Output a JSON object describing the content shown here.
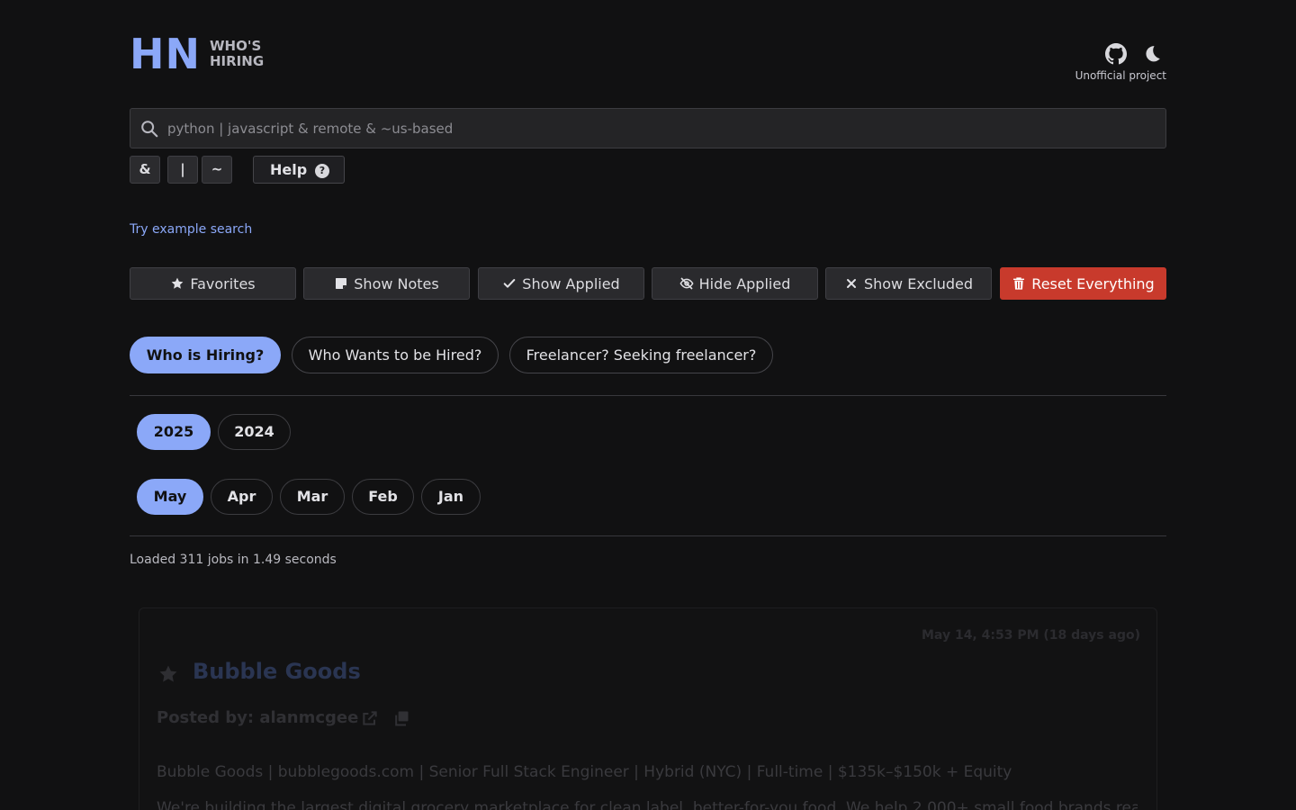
{
  "header": {
    "logo_hn": "HN",
    "logo_line1": "WHO'S",
    "logo_line2": "HIRING",
    "unofficial": "Unofficial project",
    "icons": [
      "github-icon",
      "moon-icon"
    ]
  },
  "search": {
    "placeholder": "python | javascript & remote & ~us-based",
    "value": ""
  },
  "operators": [
    "&",
    "|",
    "~"
  ],
  "help_label": "Help",
  "help_icon_glyph": "?",
  "try_example": "Try example search",
  "filters": [
    {
      "label": "Favorites",
      "icon": "star-icon"
    },
    {
      "label": "Show Notes",
      "icon": "note-icon"
    },
    {
      "label": "Show Applied",
      "icon": "check-icon"
    },
    {
      "label": "Hide Applied",
      "icon": "eye-slash-icon"
    },
    {
      "label": "Show Excluded",
      "icon": "x-icon"
    },
    {
      "label": "Reset Everything",
      "icon": "trash-icon"
    }
  ],
  "categories": [
    {
      "label": "Who is Hiring?",
      "active": true
    },
    {
      "label": "Who Wants to be Hired?",
      "active": false
    },
    {
      "label": "Freelancer? Seeking freelancer?",
      "active": false
    }
  ],
  "years": [
    {
      "label": "2025",
      "active": true
    },
    {
      "label": "2024",
      "active": false
    }
  ],
  "months": [
    {
      "label": "May",
      "active": true
    },
    {
      "label": "Apr",
      "active": false
    },
    {
      "label": "Mar",
      "active": false
    },
    {
      "label": "Feb",
      "active": false
    },
    {
      "label": "Jan",
      "active": false
    }
  ],
  "loaded_text": "Loaded 311 jobs in 1.49 seconds",
  "job": {
    "date": "May 14, 4:53 PM (18 days ago)",
    "title": "Bubble Goods",
    "posted_by": "Posted by: alanmcgee",
    "line1": "Bubble Goods | bubblegoods.com | Senior Full Stack Engineer | Hybrid (NYC) | Full-time | $135k–$150k + Equity",
    "line2": "We're building the largest digital grocery marketplace for clean label, better-for-you food. We help 2,000+ small food brands reach"
  },
  "colors": {
    "background": "#111112",
    "accent": "#8ba8f8",
    "danger": "#c83a2c"
  }
}
